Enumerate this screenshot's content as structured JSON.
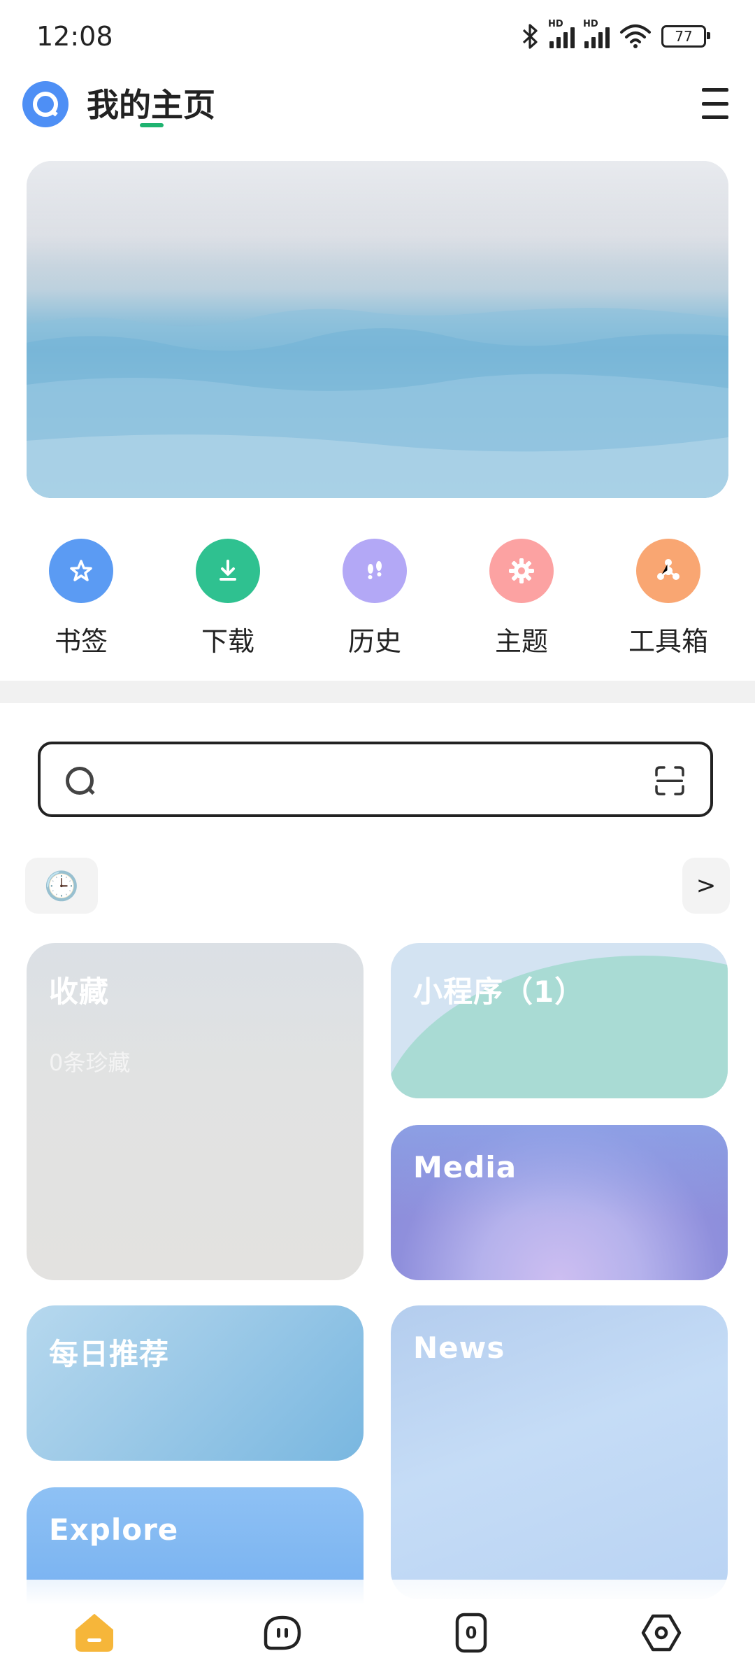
{
  "status_bar": {
    "time": "12:08",
    "battery": "77",
    "sim1_label": "HD",
    "sim2_label": "HD",
    "icons": [
      "bluetooth-icon",
      "signal-icon",
      "signal-icon",
      "wifi-icon",
      "battery-icon"
    ]
  },
  "header": {
    "title": "我的主页",
    "accent_color": "#1fb370",
    "logo_color": "#4e8ff5"
  },
  "quick_actions": [
    {
      "label": "书签",
      "icon": "star-icon",
      "color": "#5b9bf3"
    },
    {
      "label": "下载",
      "icon": "download-icon",
      "color": "#2fc190"
    },
    {
      "label": "历史",
      "icon": "footprints-icon",
      "color": "#b3a8f6"
    },
    {
      "label": "主题",
      "icon": "gear-icon",
      "color": "#fca2a2"
    },
    {
      "label": "工具箱",
      "icon": "toolbox-icon",
      "color": "#f9a672"
    }
  ],
  "search": {
    "placeholder": "",
    "history_icon": "🕒",
    "more_label": ">"
  },
  "cards": {
    "favorites": {
      "title": "收藏",
      "subtitle": "0条珍藏"
    },
    "mini_programs": {
      "title": "小程序（1）"
    },
    "media": {
      "title": "Media"
    },
    "daily": {
      "title": "每日推荐"
    },
    "news": {
      "title": "News"
    },
    "explore": {
      "title": "Explore"
    }
  },
  "bottom_nav": {
    "active_color": "#f6b63a",
    "tabs_count_label": "0",
    "items": [
      "home-icon",
      "chat-icon",
      "tabs-icon",
      "settings-icon"
    ]
  }
}
